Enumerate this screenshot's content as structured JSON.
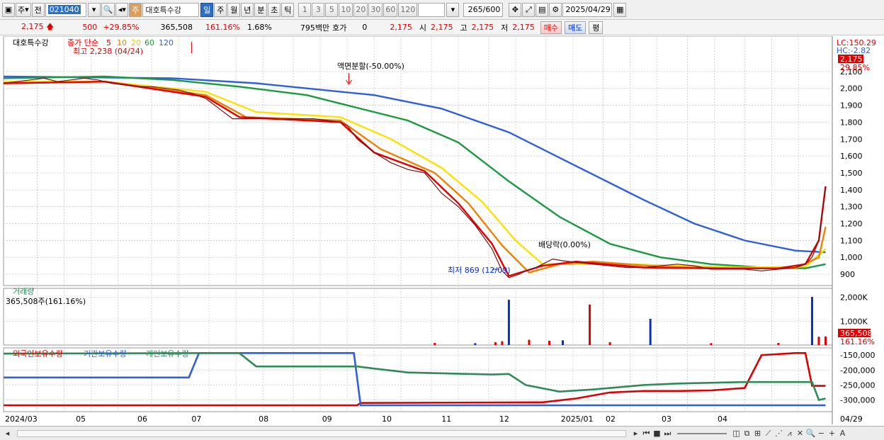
{
  "toolbar": {
    "market_btn": "주",
    "prev_btn": "전",
    "code": "021040",
    "type_tag": "주",
    "stock_name": "대호특수강",
    "periods": [
      "일",
      "주",
      "월",
      "년",
      "분",
      "초",
      "틱"
    ],
    "active_period": "일",
    "intervals": [
      "1",
      "3",
      "5",
      "10",
      "20",
      "30",
      "60",
      "120"
    ],
    "count": "265",
    "count_total": "/600",
    "date": "2025/04/29"
  },
  "quote": {
    "price": "2,175",
    "change": "500",
    "change_pct": "+29.85%",
    "volume": "365,508",
    "volume_ratio": "161.16%",
    "turnover": "1.68%",
    "amount": "795백만",
    "hoga_label": "호가",
    "hoga_value": "0",
    "hoga_price": "2,175",
    "open_label": "시",
    "open": "2,175",
    "high_label": "고",
    "high": "2,175",
    "low_label": "저",
    "low": "2,175",
    "buy_label": "매수",
    "sell_label": "매도",
    "eval_label": "평"
  },
  "panels": {
    "price_title": "대호특수강",
    "ma_legend_prefix": "종가 단순",
    "ma_periods": [
      "5",
      "10",
      "20",
      "60",
      "120"
    ],
    "high_note": "최고 2,238 (04/24)",
    "low_note": "최저 869 (12/09)",
    "split_note": "액면분할(-50.00%)",
    "dividend_note": "배당락(0.00%)",
    "lc_label": "LC:150.29",
    "hc_label": "HC:-2.82",
    "last_price_tag": "2,175",
    "last_pct_tag": "29.85%",
    "volume_title": "거래량",
    "volume_value": "365,508주(161.16%)",
    "volume_tag": "365,508",
    "volume_pct_tag": "161.16%",
    "holdings_series": [
      "외국인보유수량",
      "기관보유수량",
      "개인보유수량"
    ]
  },
  "colors": {
    "up": "#e00000",
    "down": "#0030d0",
    "ma5": "#e00000",
    "ma10": "#f08000",
    "ma20": "#ffe000",
    "ma60": "#1a9a40",
    "ma120": "#2e5fdc",
    "foreign": "#dd0000",
    "institution": "#2e5fdc",
    "individual": "#2e8b57"
  },
  "chart_data": [
    {
      "type": "line",
      "title": "대호특수강",
      "x_ticks": [
        "2024/03",
        "05",
        "06",
        "07",
        "08",
        "09",
        "10",
        "11",
        "12",
        "2025/01",
        "02",
        "03",
        "04",
        "04/29"
      ],
      "y_ticks": [
        900,
        1000,
        1100,
        1200,
        1300,
        1400,
        1500,
        1600,
        1700,
        1800,
        1900,
        2000,
        2100
      ],
      "ylim": [
        850,
        2200
      ],
      "series": [
        {
          "name": "종가",
          "points": [
            [
              0,
              2030
            ],
            [
              0.04,
              2040
            ],
            [
              0.08,
              2050
            ],
            [
              0.12,
              2060
            ],
            [
              0.16,
              2040
            ],
            [
              0.2,
              2050
            ],
            [
              0.24,
              2060
            ],
            [
              0.28,
              2050
            ],
            [
              0.32,
              2030
            ],
            [
              0.36,
              2020
            ],
            [
              0.4,
              2010
            ],
            [
              0.44,
              2010
            ],
            [
              0.48,
              2000
            ],
            [
              0.52,
              1990
            ],
            [
              0.56,
              1970
            ],
            [
              0.6,
              1940
            ],
            [
              0.64,
              1880
            ],
            [
              0.68,
              1820
            ],
            [
              0.7,
              1820
            ],
            [
              0.74,
              1820
            ],
            [
              0.78,
              1820
            ],
            [
              0.8,
              1820
            ],
            [
              0.84,
              1820
            ],
            [
              0.88,
              1820
            ],
            [
              0.92,
              1820
            ],
            [
              0.96,
              1810
            ],
            [
              1.0,
              1800
            ],
            [
              1.02,
              1780
            ],
            [
              1.05,
              1700
            ],
            [
              1.1,
              1620
            ],
            [
              1.15,
              1560
            ],
            [
              1.2,
              1520
            ],
            [
              1.25,
              1500
            ],
            [
              1.3,
              1380
            ],
            [
              1.35,
              1300
            ],
            [
              1.4,
              1190
            ],
            [
              1.45,
              1050
            ],
            [
              1.48,
              920
            ],
            [
              1.5,
              880
            ],
            [
              1.53,
              900
            ],
            [
              1.55,
              920
            ],
            [
              1.58,
              940
            ],
            [
              1.6,
              960
            ],
            [
              1.63,
              990
            ],
            [
              1.66,
              980
            ],
            [
              1.7,
              970
            ],
            [
              1.75,
              960
            ],
            [
              1.8,
              950
            ],
            [
              1.85,
              940
            ],
            [
              1.9,
              940
            ],
            [
              1.95,
              950
            ],
            [
              2.0,
              960
            ],
            [
              2.05,
              950
            ],
            [
              2.1,
              930
            ],
            [
              2.15,
              930
            ],
            [
              2.2,
              930
            ],
            [
              2.25,
              920
            ],
            [
              2.3,
              930
            ],
            [
              2.35,
              940
            ],
            [
              2.38,
              960
            ],
            [
              2.4,
              1000
            ],
            [
              2.42,
              1100
            ],
            [
              2.44,
              1420
            ]
          ]
        }
      ],
      "ma": [
        {
          "name": "5",
          "points": [
            [
              0,
              2030
            ],
            [
              0.3,
              2040
            ],
            [
              0.6,
              1950
            ],
            [
              0.7,
              1830
            ],
            [
              1.0,
              1800
            ],
            [
              1.1,
              1620
            ],
            [
              1.25,
              1510
            ],
            [
              1.35,
              1320
            ],
            [
              1.45,
              1080
            ],
            [
              1.5,
              890
            ],
            [
              1.6,
              950
            ],
            [
              1.7,
              975
            ],
            [
              1.9,
              940
            ],
            [
              2.1,
              935
            ],
            [
              2.3,
              935
            ],
            [
              2.38,
              960
            ],
            [
              2.42,
              1100
            ],
            [
              2.44,
              1420
            ]
          ]
        },
        {
          "name": "10",
          "points": [
            [
              0,
              2030
            ],
            [
              0.3,
              2040
            ],
            [
              0.6,
              1960
            ],
            [
              0.72,
              1830
            ],
            [
              1.0,
              1810
            ],
            [
              1.12,
              1640
            ],
            [
              1.28,
              1500
            ],
            [
              1.38,
              1320
            ],
            [
              1.48,
              1070
            ],
            [
              1.56,
              910
            ],
            [
              1.65,
              960
            ],
            [
              1.75,
              975
            ],
            [
              1.95,
              945
            ],
            [
              2.15,
              935
            ],
            [
              2.35,
              935
            ],
            [
              2.42,
              1000
            ],
            [
              2.44,
              1180
            ]
          ]
        },
        {
          "name": "20",
          "points": [
            [
              0,
              2040
            ],
            [
              0.3,
              2040
            ],
            [
              0.6,
              1980
            ],
            [
              0.75,
              1860
            ],
            [
              1.0,
              1830
            ],
            [
              1.15,
              1700
            ],
            [
              1.3,
              1530
            ],
            [
              1.42,
              1330
            ],
            [
              1.52,
              1100
            ],
            [
              1.6,
              960
            ],
            [
              1.7,
              960
            ],
            [
              1.85,
              960
            ],
            [
              2.0,
              950
            ],
            [
              2.2,
              940
            ],
            [
              2.38,
              945
            ],
            [
              2.44,
              1050
            ]
          ]
        },
        {
          "name": "60",
          "points": [
            [
              0,
              2060
            ],
            [
              0.3,
              2070
            ],
            [
              0.5,
              2050
            ],
            [
              0.7,
              2010
            ],
            [
              0.9,
              1960
            ],
            [
              1.0,
              1910
            ],
            [
              1.2,
              1810
            ],
            [
              1.35,
              1680
            ],
            [
              1.5,
              1450
            ],
            [
              1.65,
              1240
            ],
            [
              1.8,
              1080
            ],
            [
              1.95,
              1000
            ],
            [
              2.1,
              960
            ],
            [
              2.25,
              940
            ],
            [
              2.38,
              935
            ],
            [
              2.44,
              960
            ]
          ]
        },
        {
          "name": "120",
          "points": [
            [
              0,
              2070
            ],
            [
              0.5,
              2060
            ],
            [
              0.75,
              2030
            ],
            [
              0.9,
              2000
            ],
            [
              1.1,
              1960
            ],
            [
              1.3,
              1880
            ],
            [
              1.5,
              1740
            ],
            [
              1.7,
              1540
            ],
            [
              1.9,
              1340
            ],
            [
              2.05,
              1200
            ],
            [
              2.2,
              1100
            ],
            [
              2.35,
              1040
            ],
            [
              2.44,
              1030
            ]
          ]
        }
      ]
    },
    {
      "type": "bar",
      "title": "거래량",
      "y_ticks": [
        "1,000K",
        "2,000K"
      ],
      "ylim": [
        0,
        2200
      ],
      "annotations": [
        "365,508주(161.16%)"
      ],
      "values_k": [
        [
          1.28,
          90
        ],
        [
          1.4,
          80
        ],
        [
          1.46,
          120
        ],
        [
          1.48,
          160
        ],
        [
          1.5,
          1900
        ],
        [
          1.56,
          220
        ],
        [
          1.62,
          180
        ],
        [
          1.66,
          200
        ],
        [
          1.74,
          1700
        ],
        [
          1.8,
          120
        ],
        [
          1.92,
          1100
        ],
        [
          2.1,
          80
        ],
        [
          2.3,
          90
        ],
        [
          2.4,
          2020
        ],
        [
          2.42,
          350
        ],
        [
          2.44,
          360
        ]
      ]
    },
    {
      "type": "line",
      "title": "보유수량",
      "y_ticks": [
        -150000,
        -200000,
        -250000,
        -300000
      ],
      "ylim": [
        -325000,
        -140000
      ],
      "series": [
        {
          "name": "외국인보유수량",
          "points": [
            [
              0,
              -318000
            ],
            [
              1.05,
              -318000
            ],
            [
              1.06,
              -310000
            ],
            [
              1.6,
              -308000
            ],
            [
              1.7,
              -295000
            ],
            [
              1.8,
              -275000
            ],
            [
              1.9,
              -270000
            ],
            [
              2.0,
              -270000
            ],
            [
              2.1,
              -268000
            ],
            [
              2.2,
              -260000
            ],
            [
              2.25,
              -150000
            ],
            [
              2.35,
              -143000
            ],
            [
              2.38,
              -143000
            ],
            [
              2.4,
              -253000
            ],
            [
              2.44,
              -253000
            ]
          ]
        },
        {
          "name": "기관보유수량",
          "points": [
            [
              0,
              -225000
            ],
            [
              0.55,
              -225000
            ],
            [
              0.58,
              -143000
            ],
            [
              1.04,
              -143000
            ],
            [
              1.06,
              -318000
            ],
            [
              2.4,
              -318000
            ],
            [
              2.42,
              -318000
            ],
            [
              2.44,
              -318000
            ]
          ]
        },
        {
          "name": "개인보유수량",
          "points": [
            [
              0,
              -145000
            ],
            [
              0.6,
              -143000
            ],
            [
              0.7,
              -143000
            ],
            [
              0.75,
              -188000
            ],
            [
              1.05,
              -188000
            ],
            [
              1.1,
              -195000
            ],
            [
              1.2,
              -208000
            ],
            [
              1.45,
              -215000
            ],
            [
              1.5,
              -213000
            ],
            [
              1.55,
              -250000
            ],
            [
              1.65,
              -272000
            ],
            [
              1.75,
              -265000
            ],
            [
              1.9,
              -250000
            ],
            [
              2.0,
              -245000
            ],
            [
              2.2,
              -240000
            ],
            [
              2.3,
              -240000
            ],
            [
              2.4,
              -240000
            ],
            [
              2.42,
              -300000
            ],
            [
              2.44,
              -295000
            ]
          ]
        }
      ],
      "legend_position": "top-left"
    }
  ]
}
